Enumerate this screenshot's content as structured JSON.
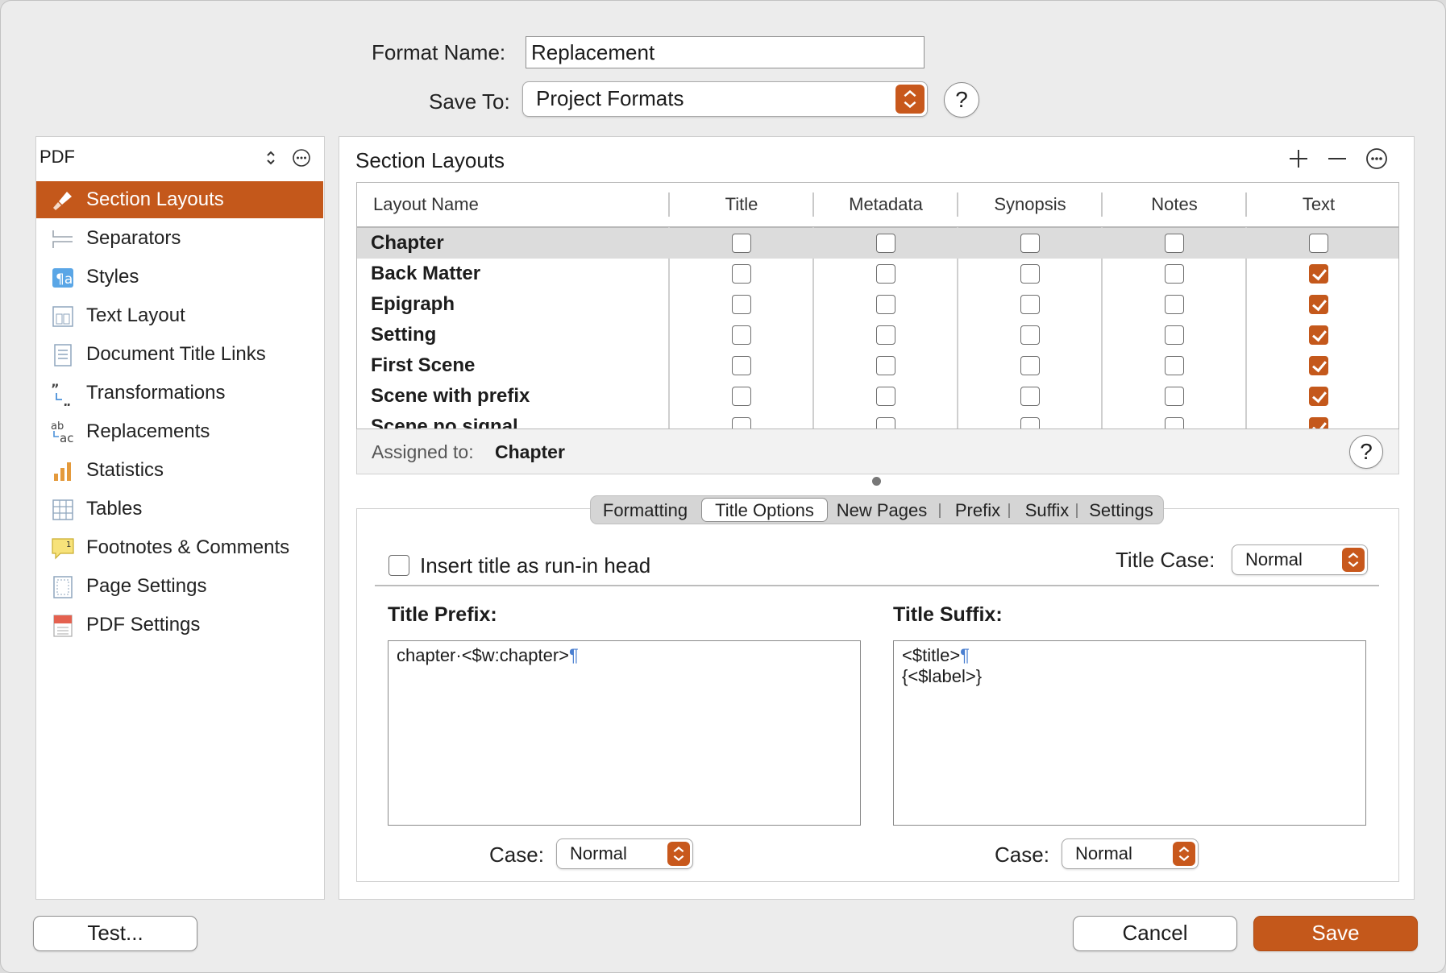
{
  "header": {
    "format_name_label": "Format Name:",
    "format_name_value": "Replacement",
    "save_to_label": "Save To:",
    "save_to_value": "Project Formats",
    "help": "?"
  },
  "sidebar": {
    "selector_value": "PDF",
    "items": [
      {
        "label": "Section Layouts",
        "icon": "brush-icon",
        "selected": true
      },
      {
        "label": "Separators",
        "icon": "separator-icon"
      },
      {
        "label": "Styles",
        "icon": "styles-icon"
      },
      {
        "label": "Text Layout",
        "icon": "text-layout-icon"
      },
      {
        "label": "Document Title Links",
        "icon": "document-icon"
      },
      {
        "label": "Transformations",
        "icon": "quotes-transform-icon"
      },
      {
        "label": "Replacements",
        "icon": "ab-ac-replace-icon"
      },
      {
        "label": "Statistics",
        "icon": "bar-chart-icon"
      },
      {
        "label": "Tables",
        "icon": "table-icon"
      },
      {
        "label": "Footnotes & Comments",
        "icon": "footnote-icon"
      },
      {
        "label": "Page Settings",
        "icon": "page-settings-icon"
      },
      {
        "label": "PDF Settings",
        "icon": "pdf-icon"
      }
    ]
  },
  "main": {
    "title": "Section Layouts",
    "columns": [
      "Layout Name",
      "Title",
      "Metadata",
      "Synopsis",
      "Notes",
      "Text"
    ],
    "rows": [
      {
        "name": "Chapter",
        "checks": [
          false,
          false,
          false,
          false,
          false
        ],
        "selected": true
      },
      {
        "name": "Back Matter",
        "checks": [
          false,
          false,
          false,
          false,
          true
        ]
      },
      {
        "name": "Epigraph",
        "checks": [
          false,
          false,
          false,
          false,
          true
        ]
      },
      {
        "name": "Setting",
        "checks": [
          false,
          false,
          false,
          false,
          true
        ]
      },
      {
        "name": "First Scene",
        "checks": [
          false,
          false,
          false,
          false,
          true
        ]
      },
      {
        "name": "Scene with prefix",
        "checks": [
          false,
          false,
          false,
          false,
          true
        ]
      },
      {
        "name": "Scene no signal",
        "checks": [
          false,
          false,
          false,
          false,
          true
        ]
      }
    ],
    "assigned_label": "Assigned to:",
    "assigned_value": "Chapter"
  },
  "tabs": [
    "Formatting",
    "Title Options",
    "New Pages",
    "Prefix",
    "Suffix",
    "Settings"
  ],
  "active_tab": "Title Options",
  "options": {
    "run_in_label": "Insert title as run-in head",
    "run_in_checked": false,
    "title_case_label": "Title Case:",
    "title_case_value": "Normal",
    "prefix_label": "Title Prefix:",
    "prefix_line1": "chapter·<$w:chapter>",
    "suffix_label": "Title Suffix:",
    "suffix_line1": "<$title>",
    "suffix_line2": "{<$label>}",
    "pilcrow": "¶",
    "case_label": "Case:",
    "prefix_case_value": "Normal",
    "suffix_case_value": "Normal"
  },
  "footer": {
    "test_label": "Test...",
    "cancel_label": "Cancel",
    "save_label": "Save"
  },
  "colors": {
    "accent": "#c4581b"
  }
}
